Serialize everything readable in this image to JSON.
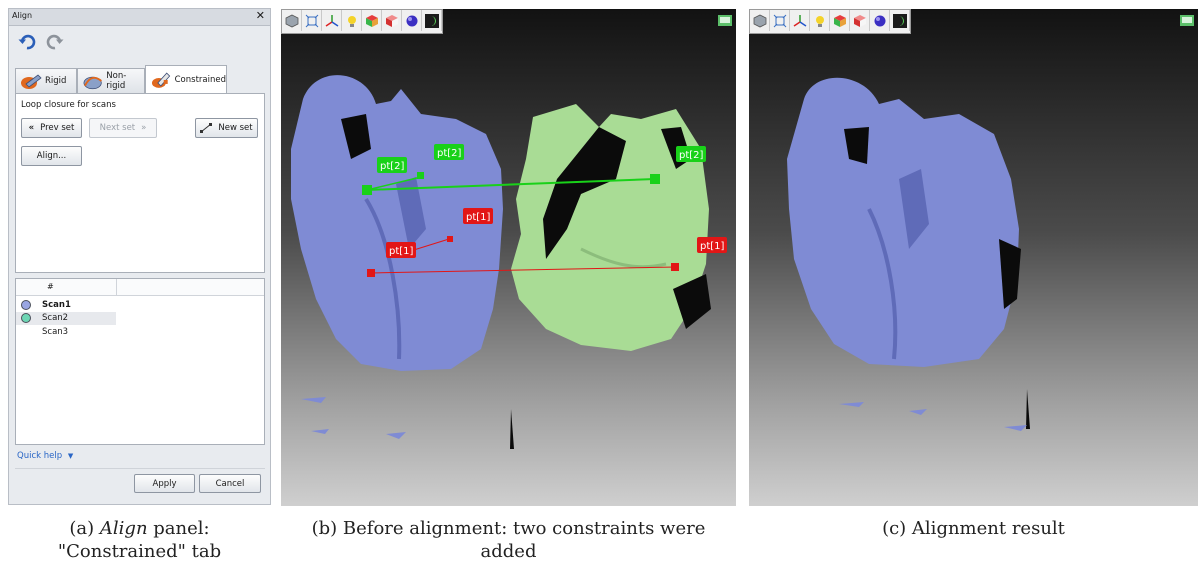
{
  "panel": {
    "title": "Align",
    "tabs": [
      {
        "label": "Rigid"
      },
      {
        "label": "Non-rigid"
      },
      {
        "label": "Constrained"
      }
    ],
    "section_label": "Loop closure for scans",
    "buttons": {
      "prev_set": "Prev set",
      "next_set": "Next set",
      "new_set": "New set",
      "align": "Align..."
    },
    "list": {
      "column_header": "#",
      "rows": [
        {
          "name": "Scan1",
          "dot_color": "#9aa6e2"
        },
        {
          "name": "Scan2",
          "dot_color": "#6dd6b4"
        },
        {
          "name": "Scan3",
          "dot_color": ""
        }
      ]
    },
    "quick_help": "Quick help",
    "apply": "Apply",
    "cancel": "Cancel"
  },
  "viewport_b": {
    "labels": {
      "pt2_left": "pt[2]",
      "pt2_mid": "pt[2]",
      "pt2_right": "pt[2]",
      "pt1_mid": "pt[1]",
      "pt1_left": "pt[1]",
      "pt1_right": "pt[1]"
    }
  },
  "colors": {
    "scan_blue": "#7f8bd4",
    "scan_green": "#a9dc95",
    "constraint_green": "#19d119",
    "constraint_red": "#e21616"
  },
  "captions": {
    "a_prefix": "(a) ",
    "a_emph": "Align",
    "a_rest": " panel:",
    "a_line2": "\"Constrained\" tab",
    "b": "(b) Before alignment: two constraints were added",
    "c": "(c) Alignment result"
  }
}
